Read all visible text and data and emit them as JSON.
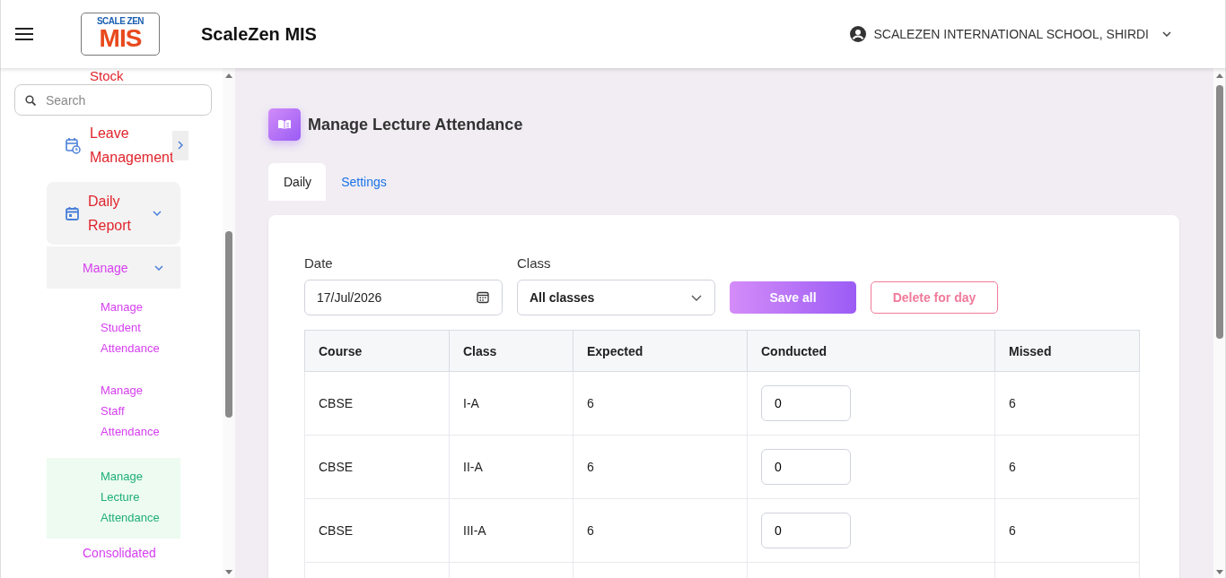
{
  "header": {
    "logo": {
      "line_1": "SCALE ZEN",
      "line_2": "MIS"
    },
    "app_name": "ScaleZen MIS",
    "school": "SCALEZEN INTERNATIONAL SCHOOL, SHIRDI"
  },
  "sidebar": {
    "partial_item": "Stock",
    "search": {
      "placeholder": "Search"
    },
    "items": [
      {
        "label": "Leave Management",
        "expanded": false
      },
      {
        "label": "Daily Report",
        "expanded": true,
        "children": [
          {
            "label": "Manage",
            "expanded": true,
            "children": [
              {
                "label": "Manage Student Attendance",
                "selected": false
              },
              {
                "label": "Manage Staff Attendance",
                "selected": false
              },
              {
                "label": "Manage Lecture Attendance",
                "selected": true
              }
            ]
          },
          {
            "label": "Consolidated"
          }
        ]
      }
    ]
  },
  "page": {
    "title": "Manage Lecture Attendance",
    "tabs": [
      {
        "label": "Daily",
        "selected": true
      },
      {
        "label": "Settings",
        "selected": false
      }
    ],
    "filters": {
      "date": {
        "label": "Date",
        "value": "17/Jul/2026"
      },
      "class": {
        "label": "Class",
        "value": "All classes"
      }
    },
    "buttons": [
      {
        "label": "Save all",
        "kind": "primary"
      },
      {
        "label": "Delete for day",
        "kind": "danger"
      }
    ],
    "table": {
      "columns": [
        "Course",
        "Class",
        "Expected",
        "Conducted",
        "Missed"
      ],
      "rows": [
        {
          "course": "CBSE",
          "class": "I-A",
          "expected": "6",
          "conducted": "0",
          "missed": "6"
        },
        {
          "course": "CBSE",
          "class": "II-A",
          "expected": "6",
          "conducted": "0",
          "missed": "6"
        },
        {
          "course": "CBSE",
          "class": "III-A",
          "expected": "6",
          "conducted": "0",
          "missed": "6"
        }
      ]
    }
  }
}
